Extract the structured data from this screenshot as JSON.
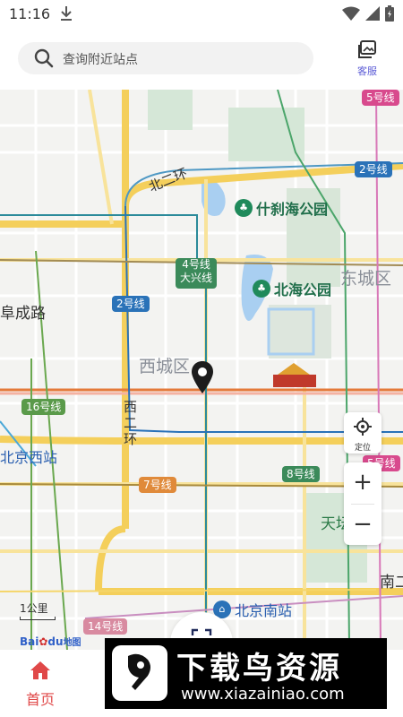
{
  "status": {
    "time": "11:16"
  },
  "search": {
    "placeholder": "查询附近站点"
  },
  "header": {
    "service_label": "客服"
  },
  "map": {
    "line_badges": [
      {
        "label": "5号线",
        "color": "#d84a8d"
      },
      {
        "label": "2号线",
        "color": "#2a72b8"
      },
      {
        "label": "4号线\n大兴线",
        "color": "#3b8a5a"
      },
      {
        "label": "2号线",
        "color": "#2a72b8"
      },
      {
        "label": "16号线",
        "color": "#5a9a4a"
      },
      {
        "label": "8号线",
        "color": "#3b8a5a"
      },
      {
        "label": "5号线",
        "color": "#d84a8d"
      },
      {
        "label": "7号线",
        "color": "#e08a3a"
      },
      {
        "label": "14号线",
        "color": "#d88aa0"
      }
    ],
    "district_labels": [
      "东城区",
      "西城区",
      "阜成路",
      "北二环",
      "西二环",
      "天坛",
      "南二"
    ],
    "pois": [
      "什刹海公园",
      "北海公园"
    ],
    "stations": [
      "北京西站",
      "北京南站"
    ],
    "scale": "1公里",
    "logo": {
      "brand": "Bai",
      "du": "du",
      "suffix": "地图"
    },
    "locate_label": "定位",
    "zoom_in": "+",
    "zoom_out": "−"
  },
  "tabbar": {
    "home_label": "首页"
  },
  "watermark": {
    "title": "下载鸟资源",
    "url": "www.xiazainiao.com"
  }
}
